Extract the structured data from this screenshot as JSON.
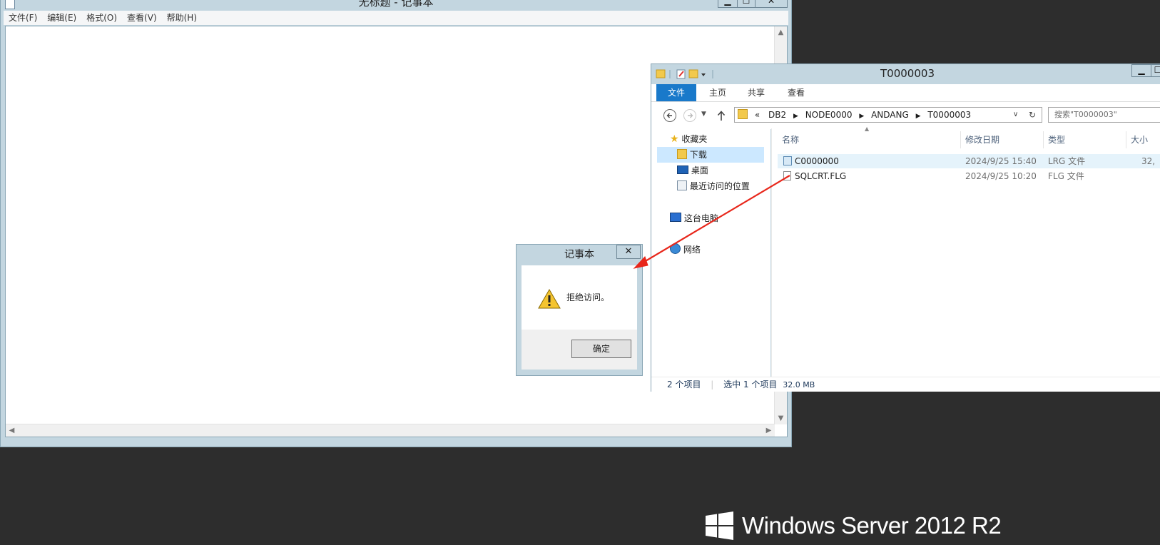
{
  "notepad": {
    "title": "无标题 - 记事本",
    "menu": [
      "文件(F)",
      "编辑(E)",
      "格式(O)",
      "查看(V)",
      "帮助(H)"
    ],
    "controls": {
      "minimize": "▁",
      "maximize": "☐",
      "close": "✕"
    }
  },
  "dialog": {
    "title": "记事本",
    "message": "拒绝访问。",
    "ok_label": "确定",
    "close_label": "✕"
  },
  "explorer": {
    "title": "T0000003",
    "ribbon_tabs": [
      "文件",
      "主页",
      "共享",
      "查看"
    ],
    "breadcrumb": [
      "DB2",
      "NODE0000",
      "ANDANG",
      "T0000003"
    ],
    "breadcrumb_prefix": "«",
    "search_placeholder": "搜索\"T0000003\"",
    "nav": {
      "favorites": "收藏夹",
      "downloads": "下载",
      "desktop": "桌面",
      "recent": "最近访问的位置",
      "this_pc": "这台电脑",
      "network": "网络"
    },
    "columns": [
      "名称",
      "修改日期",
      "类型",
      "大小"
    ],
    "files": [
      {
        "name": "C0000000",
        "date": "2024/9/25 15:40",
        "type": "LRG 文件",
        "size": "32,"
      },
      {
        "name": "SQLCRT.FLG",
        "date": "2024/9/25 10:20",
        "type": "FLG 文件",
        "size": ""
      }
    ],
    "status": {
      "count": "2 个项目",
      "selected": "选中 1 个项目",
      "size": "32.0 MB"
    }
  },
  "watermark": "Windows Server 2012 R2",
  "colors": {
    "title_bar": "#c3d6e0",
    "ribbon_active": "#1979ca",
    "annotation_arrow": "#e8271b",
    "desktop": "#2d2d2d"
  }
}
